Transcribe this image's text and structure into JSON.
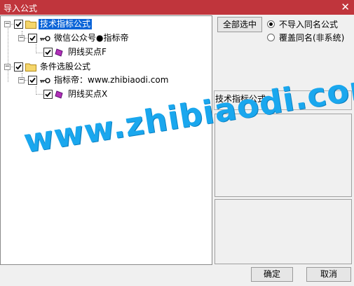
{
  "window": {
    "title": "导入公式",
    "close_glyph": "✕"
  },
  "tree": {
    "groups": [
      {
        "label": "技术指标公式",
        "checked": true,
        "author": "微信公众号●指标帝",
        "formula": "阴线买点F"
      },
      {
        "label": "条件选股公式",
        "checked": true,
        "author": "指标帝：www.zhibiaodi.com",
        "formula": "阴线买点X"
      }
    ]
  },
  "buttons": {
    "select_all": "全部选中",
    "ok": "确定",
    "cancel": "取消"
  },
  "options": {
    "no_import_same": "不导入同名公式",
    "overwrite_same": "覆盖同名(非系统)",
    "selected": "no_import_same"
  },
  "detail": {
    "type_label": "技术指标公式"
  },
  "watermark": {
    "text": "www.zhibiaodi.com"
  },
  "colors": {
    "title_bar": "#c0353c",
    "selection": "#0a64d8",
    "watermark": "#1aa7ee"
  },
  "icons": [
    "folder-icon",
    "key-icon",
    "formula-icon",
    "checkbox-icon"
  ]
}
